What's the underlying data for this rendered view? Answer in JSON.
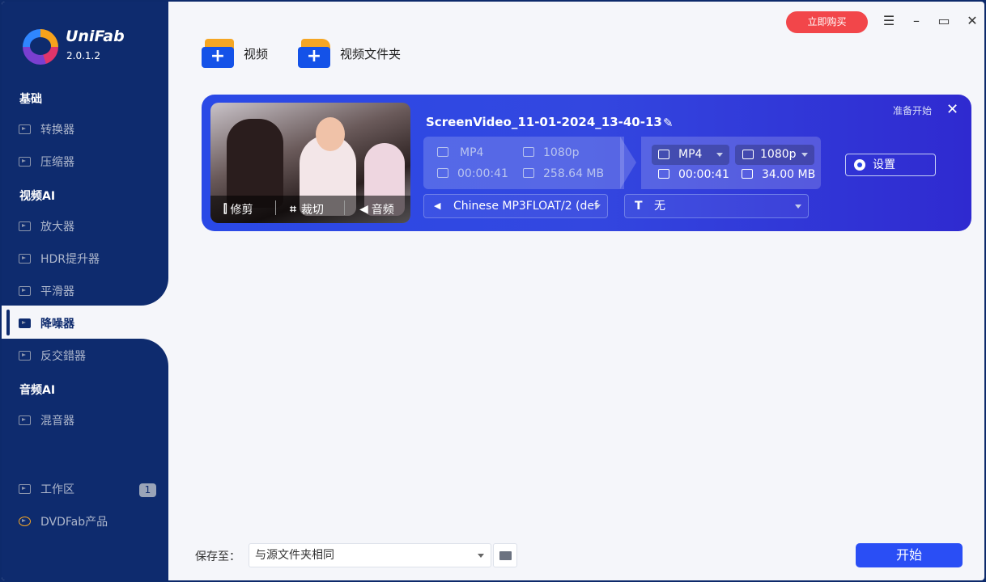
{
  "app": {
    "name": "UniFab",
    "version": "2.0.1.2"
  },
  "sidebar": {
    "sections": {
      "basic": "基础",
      "video_ai": "视频AI",
      "audio_ai": "音频AI"
    },
    "items": [
      {
        "label": "转换器"
      },
      {
        "label": "压缩器"
      },
      {
        "label": "放大器"
      },
      {
        "label": "HDR提升器"
      },
      {
        "label": "平滑器"
      },
      {
        "label": "降噪器"
      },
      {
        "label": "反交錯器"
      },
      {
        "label": "混音器"
      }
    ],
    "workspace": {
      "label": "工作区",
      "count": "1"
    },
    "dvdfab": {
      "label": "DVDFab产品"
    }
  },
  "header": {
    "buy_label": "立即购买"
  },
  "toolbar": {
    "add_video": "视频",
    "add_folder": "视频文件夹"
  },
  "task": {
    "filename": "ScreenVideo_11-01-2024_13-40-13",
    "status": "准备开始",
    "thumb_actions": {
      "trim": "修剪",
      "crop": "裁切",
      "audio": "音频"
    },
    "source": {
      "format": "MP4",
      "resolution": "1080p",
      "duration": "00:00:41",
      "size": "258.64 MB"
    },
    "output": {
      "format": "MP4",
      "resolution": "1080p",
      "duration": "00:00:41",
      "size": "34.00 MB"
    },
    "audio_track": "Chinese MP3FLOAT/2 (def",
    "subtitle": "无",
    "settings_label": "设置"
  },
  "footer": {
    "save_to_label": "保存至：",
    "save_to_value": "与源文件夹相同",
    "start_label": "开始"
  },
  "colors": {
    "sidebar": "#0e2b6e",
    "card": "#2a49e6",
    "buy": "#f2464a",
    "start": "#2a4ef5"
  }
}
